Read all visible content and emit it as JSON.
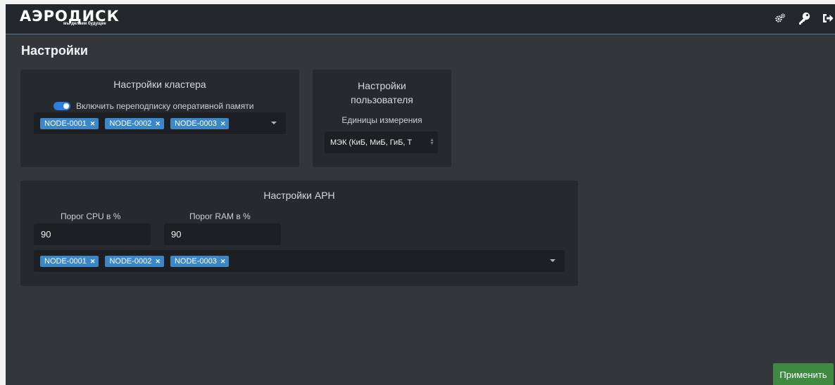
{
  "brand": {
    "name": "АЭРОДИСК",
    "tagline": "мы делаем будущее"
  },
  "header_icons": [
    "cogs-icon",
    "key-icon",
    "logout-icon"
  ],
  "page": {
    "title": "Настройки"
  },
  "cluster": {
    "title": "Настройки кластера",
    "toggle_label": "Включить переподписку оперативной памяти",
    "toggle_on": true,
    "nodes": [
      "NODE-0001",
      "NODE-0002",
      "NODE-0003"
    ]
  },
  "user": {
    "title_line1": "Настройки",
    "title_line2": "пользователя",
    "units_label": "Единицы измерения",
    "units_value": "МЭК (КиБ, МиБ, ГиБ, Т"
  },
  "arn": {
    "title": "Настройки АРН",
    "cpu_label": "Порог CPU в %",
    "cpu_value": "90",
    "ram_label": "Порог RAM в %",
    "ram_value": "90",
    "nodes": [
      "NODE-0001",
      "NODE-0002",
      "NODE-0003"
    ]
  },
  "actions": {
    "apply_label": "Применить"
  },
  "colors": {
    "background": "#33363b",
    "header": "#24272c",
    "card": "#26292d",
    "tag": "#3b87c7",
    "toggle": "#2a7de1",
    "apply": "#3f8a40"
  }
}
